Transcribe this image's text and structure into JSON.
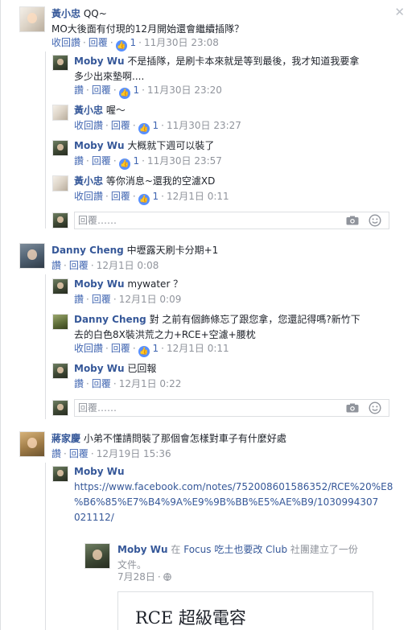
{
  "close": "✕",
  "c1": {
    "author": "黃小忠",
    "text_l1": "QQ~",
    "text_l2": "MO大後面有付現的12月開始還會繼續插隊？",
    "actions": [
      "收回讚",
      "回覆"
    ],
    "likes": "1",
    "time": "11月30日 23:08"
  },
  "r1": {
    "author": "Moby Wu",
    "text_l1": "不是插隊，是刷卡本來就是等到最後，我才知道我要拿",
    "text_l2": "多少出來墊啊....",
    "actions": [
      "讚",
      "回覆"
    ],
    "likes": "1",
    "time": "11月30日 23:20"
  },
  "r2": {
    "author": "黃小忠",
    "text": "喔～",
    "actions": [
      "收回讚",
      "回覆"
    ],
    "likes": "1",
    "time": "11月30日 23:27"
  },
  "r3": {
    "author": "Moby Wu",
    "text": "大概就下週可以裝了",
    "actions": [
      "讚",
      "回覆"
    ],
    "likes": "1",
    "time": "11月30日 23:57"
  },
  "r4": {
    "author": "黃小忠",
    "text": "等你消息~還我的空濾XD",
    "actions": [
      "收回讚",
      "回覆"
    ],
    "likes": "1",
    "time": "12月1日 0:11"
  },
  "reply_placeholder_1": "回覆……",
  "c2": {
    "author": "Danny Cheng",
    "text": "中壢露天刷卡分期+1",
    "actions": [
      "讚",
      "回覆"
    ],
    "time": "12月1日 0:08"
  },
  "r5": {
    "author": "Moby Wu",
    "text": "mywater ？",
    "actions": [
      "讚",
      "回覆"
    ],
    "time": "12月1日 0:09"
  },
  "r6": {
    "author": "Danny Cheng",
    "text_l1": "對 之前有個飾條忘了跟您拿，您還記得嗎?新竹下",
    "text_l2": "去的白色8X裝洪荒之力+RCE+空濾+腰枕",
    "actions": [
      "收回讚",
      "回覆"
    ],
    "likes": "1",
    "time": "12月1日 0:11"
  },
  "r7": {
    "author": "Moby Wu",
    "text": "已回報",
    "actions": [
      "讚",
      "回覆"
    ],
    "time": "12月1日 0:22"
  },
  "reply_placeholder_2": "回覆……",
  "c3": {
    "author": "蔣家慶",
    "text": "小弟不懂請問裝了那個會怎樣對車子有什麼好處",
    "actions": [
      "讚",
      "回覆"
    ],
    "time": "12月19日 15:36"
  },
  "r8": {
    "author": "Moby Wu",
    "link_l1": "https://www.facebook.com/notes/752008601586352/RCE%20%E8",
    "link_l2": "%B6%85%E7%B4%9A%E9%9B%BB%E5%AE%B9/1030994307",
    "link_l3": "021112/"
  },
  "share": {
    "author": "Moby Wu",
    "in": "在",
    "group": "Focus 吃土也要改 Club",
    "action_l1": "社團建立了一份",
    "action_l2": "文件。",
    "time": "7月28日",
    "card_title": "RCE 超級電容"
  },
  "icons": {
    "like": "like-thumb-icon",
    "camera": "camera-icon",
    "emoji": "smiley-icon",
    "globe": "globe-icon"
  },
  "colors": {
    "link": "#365899",
    "action": "#4267b2",
    "meta": "#90949c",
    "like_badge": "#5890ff"
  }
}
